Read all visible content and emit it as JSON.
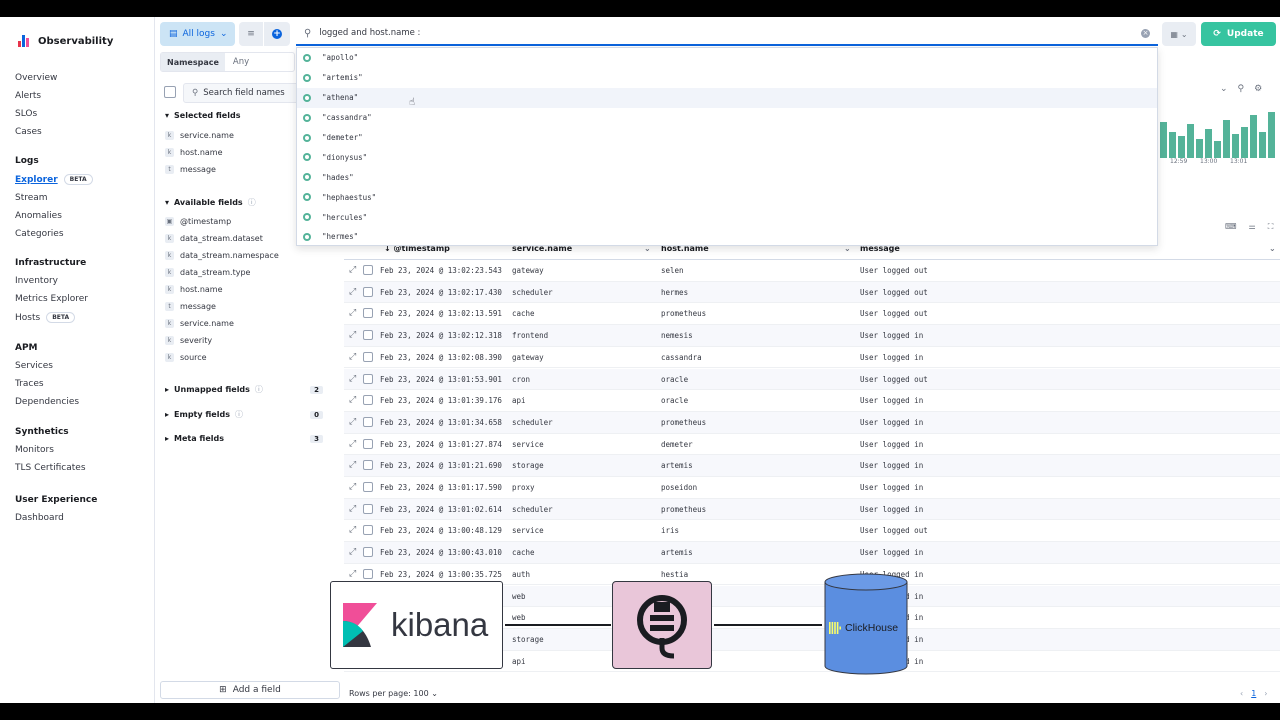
{
  "app": {
    "title": "Observability"
  },
  "nav": {
    "top_items": [
      "Overview",
      "Alerts",
      "SLOs",
      "Cases"
    ],
    "groups": [
      {
        "title": "Logs",
        "items": [
          {
            "label": "Explorer",
            "badge": "BETA",
            "active": true
          },
          {
            "label": "Stream"
          },
          {
            "label": "Anomalies"
          },
          {
            "label": "Categories"
          }
        ]
      },
      {
        "title": "Infrastructure",
        "items": [
          {
            "label": "Inventory"
          },
          {
            "label": "Metrics Explorer"
          },
          {
            "label": "Hosts",
            "badge": "BETA"
          }
        ]
      },
      {
        "title": "APM",
        "items": [
          {
            "label": "Services"
          },
          {
            "label": "Traces"
          },
          {
            "label": "Dependencies"
          }
        ]
      },
      {
        "title": "Synthetics",
        "items": [
          {
            "label": "Monitors"
          },
          {
            "label": "TLS Certificates"
          }
        ]
      },
      {
        "title": "User Experience",
        "items": [
          {
            "label": "Dashboard"
          }
        ]
      }
    ]
  },
  "toolbar": {
    "data_view_label": "All logs",
    "query": "logged and host.name :",
    "update_label": "Update"
  },
  "namespace": {
    "label": "Namespace",
    "value": "Any"
  },
  "fields": {
    "search_placeholder": "Search field names",
    "selected_title": "Selected fields",
    "selected": [
      {
        "type": "k",
        "name": "service.name"
      },
      {
        "type": "k",
        "name": "host.name"
      },
      {
        "type": "t",
        "name": "message"
      }
    ],
    "available_title": "Available fields",
    "available": [
      {
        "type": "▣",
        "name": "@timestamp"
      },
      {
        "type": "k",
        "name": "data_stream.dataset"
      },
      {
        "type": "k",
        "name": "data_stream.namespace"
      },
      {
        "type": "k",
        "name": "data_stream.type"
      },
      {
        "type": "k",
        "name": "host.name"
      },
      {
        "type": "t",
        "name": "message"
      },
      {
        "type": "k",
        "name": "service.name"
      },
      {
        "type": "k",
        "name": "severity"
      },
      {
        "type": "k",
        "name": "source"
      }
    ],
    "unmapped_title": "Unmapped fields",
    "unmapped_count": "2",
    "empty_title": "Empty fields",
    "empty_count": "0",
    "meta_title": "Meta fields",
    "meta_count": "3",
    "add_field_label": "Add a field"
  },
  "suggestions": [
    "\"apollo\"",
    "\"artemis\"",
    "\"athena\"",
    "\"cassandra\"",
    "\"demeter\"",
    "\"dionysus\"",
    "\"hades\"",
    "\"hephaestus\"",
    "\"hercules\"",
    "\"hermes\""
  ],
  "histogram": {
    "tick_labels": [
      "12:59",
      "13:00",
      "13:01"
    ],
    "bars": [
      0.75,
      0.55,
      0.45,
      0.7,
      0.4,
      0.6,
      0.35,
      0.8,
      0.5,
      0.65,
      0.9,
      0.55,
      0.95
    ]
  },
  "table": {
    "columns": [
      "@timestamp",
      "service.name",
      "host.name",
      "message"
    ],
    "rows": [
      [
        "Feb 23, 2024 @ 13:02:23.543",
        "gateway",
        "selen",
        "User logged out"
      ],
      [
        "Feb 23, 2024 @ 13:02:17.430",
        "scheduler",
        "hermes",
        "User logged out"
      ],
      [
        "Feb 23, 2024 @ 13:02:13.591",
        "cache",
        "prometheus",
        "User logged out"
      ],
      [
        "Feb 23, 2024 @ 13:02:12.318",
        "frontend",
        "nemesis",
        "User logged in"
      ],
      [
        "Feb 23, 2024 @ 13:02:08.390",
        "gateway",
        "cassandra",
        "User logged in"
      ],
      [
        "Feb 23, 2024 @ 13:01:53.901",
        "cron",
        "oracle",
        "User logged out"
      ],
      [
        "Feb 23, 2024 @ 13:01:39.176",
        "api",
        "oracle",
        "User logged in"
      ],
      [
        "Feb 23, 2024 @ 13:01:34.658",
        "scheduler",
        "prometheus",
        "User logged in"
      ],
      [
        "Feb 23, 2024 @ 13:01:27.874",
        "service",
        "demeter",
        "User logged in"
      ],
      [
        "Feb 23, 2024 @ 13:01:21.690",
        "storage",
        "artemis",
        "User logged in"
      ],
      [
        "Feb 23, 2024 @ 13:01:17.590",
        "proxy",
        "poseidon",
        "User logged in"
      ],
      [
        "Feb 23, 2024 @ 13:01:02.614",
        "scheduler",
        "prometheus",
        "User logged in"
      ],
      [
        "Feb 23, 2024 @ 13:00:48.129",
        "service",
        "iris",
        "User logged out"
      ],
      [
        "Feb 23, 2024 @ 13:00:43.010",
        "cache",
        "artemis",
        "User logged in"
      ],
      [
        "Feb 23, 2024 @ 13:00:35.725",
        "auth",
        "hestia",
        "User logged in"
      ],
      [
        "",
        "web",
        "",
        "User logged in"
      ],
      [
        "",
        "web",
        "",
        "User logged in"
      ],
      [
        "",
        "storage",
        "",
        "User logged in"
      ],
      [
        "",
        "api",
        "",
        "User logged in"
      ]
    ],
    "rows_per_page_label": "Rows per page: 100",
    "page": "1"
  },
  "overlay": {
    "kibana_label": "kibana",
    "clickhouse_label": "ClickHouse"
  },
  "colors": {
    "accent": "#0b64dd",
    "update_button": "#36c4a0",
    "histogram_bar": "#54b399",
    "kibana_pink": "#e7344c",
    "proxy_bg": "#e9c6d9",
    "clickhouse_blue": "#5b8ee0"
  }
}
